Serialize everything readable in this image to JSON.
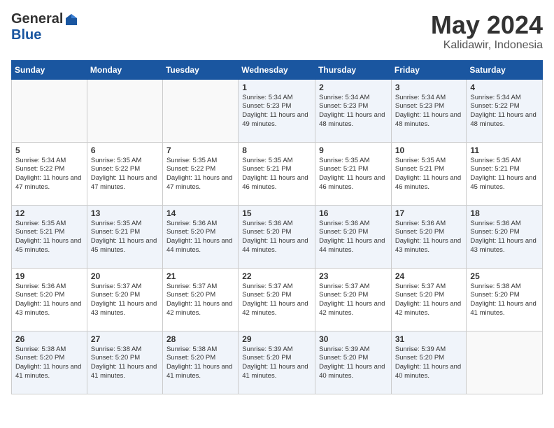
{
  "logo": {
    "general": "General",
    "blue": "Blue"
  },
  "title": "May 2024",
  "subtitle": "Kalidawir, Indonesia",
  "headers": [
    "Sunday",
    "Monday",
    "Tuesday",
    "Wednesday",
    "Thursday",
    "Friday",
    "Saturday"
  ],
  "weeks": [
    [
      {
        "day": "",
        "info": ""
      },
      {
        "day": "",
        "info": ""
      },
      {
        "day": "",
        "info": ""
      },
      {
        "day": "1",
        "info": "Sunrise: 5:34 AM\nSunset: 5:23 PM\nDaylight: 11 hours\nand 49 minutes."
      },
      {
        "day": "2",
        "info": "Sunrise: 5:34 AM\nSunset: 5:23 PM\nDaylight: 11 hours\nand 48 minutes."
      },
      {
        "day": "3",
        "info": "Sunrise: 5:34 AM\nSunset: 5:23 PM\nDaylight: 11 hours\nand 48 minutes."
      },
      {
        "day": "4",
        "info": "Sunrise: 5:34 AM\nSunset: 5:22 PM\nDaylight: 11 hours\nand 48 minutes."
      }
    ],
    [
      {
        "day": "5",
        "info": "Sunrise: 5:34 AM\nSunset: 5:22 PM\nDaylight: 11 hours\nand 47 minutes."
      },
      {
        "day": "6",
        "info": "Sunrise: 5:35 AM\nSunset: 5:22 PM\nDaylight: 11 hours\nand 47 minutes."
      },
      {
        "day": "7",
        "info": "Sunrise: 5:35 AM\nSunset: 5:22 PM\nDaylight: 11 hours\nand 47 minutes."
      },
      {
        "day": "8",
        "info": "Sunrise: 5:35 AM\nSunset: 5:21 PM\nDaylight: 11 hours\nand 46 minutes."
      },
      {
        "day": "9",
        "info": "Sunrise: 5:35 AM\nSunset: 5:21 PM\nDaylight: 11 hours\nand 46 minutes."
      },
      {
        "day": "10",
        "info": "Sunrise: 5:35 AM\nSunset: 5:21 PM\nDaylight: 11 hours\nand 46 minutes."
      },
      {
        "day": "11",
        "info": "Sunrise: 5:35 AM\nSunset: 5:21 PM\nDaylight: 11 hours\nand 45 minutes."
      }
    ],
    [
      {
        "day": "12",
        "info": "Sunrise: 5:35 AM\nSunset: 5:21 PM\nDaylight: 11 hours\nand 45 minutes."
      },
      {
        "day": "13",
        "info": "Sunrise: 5:35 AM\nSunset: 5:21 PM\nDaylight: 11 hours\nand 45 minutes."
      },
      {
        "day": "14",
        "info": "Sunrise: 5:36 AM\nSunset: 5:20 PM\nDaylight: 11 hours\nand 44 minutes."
      },
      {
        "day": "15",
        "info": "Sunrise: 5:36 AM\nSunset: 5:20 PM\nDaylight: 11 hours\nand 44 minutes."
      },
      {
        "day": "16",
        "info": "Sunrise: 5:36 AM\nSunset: 5:20 PM\nDaylight: 11 hours\nand 44 minutes."
      },
      {
        "day": "17",
        "info": "Sunrise: 5:36 AM\nSunset: 5:20 PM\nDaylight: 11 hours\nand 43 minutes."
      },
      {
        "day": "18",
        "info": "Sunrise: 5:36 AM\nSunset: 5:20 PM\nDaylight: 11 hours\nand 43 minutes."
      }
    ],
    [
      {
        "day": "19",
        "info": "Sunrise: 5:36 AM\nSunset: 5:20 PM\nDaylight: 11 hours\nand 43 minutes."
      },
      {
        "day": "20",
        "info": "Sunrise: 5:37 AM\nSunset: 5:20 PM\nDaylight: 11 hours\nand 43 minutes."
      },
      {
        "day": "21",
        "info": "Sunrise: 5:37 AM\nSunset: 5:20 PM\nDaylight: 11 hours\nand 42 minutes."
      },
      {
        "day": "22",
        "info": "Sunrise: 5:37 AM\nSunset: 5:20 PM\nDaylight: 11 hours\nand 42 minutes."
      },
      {
        "day": "23",
        "info": "Sunrise: 5:37 AM\nSunset: 5:20 PM\nDaylight: 11 hours\nand 42 minutes."
      },
      {
        "day": "24",
        "info": "Sunrise: 5:37 AM\nSunset: 5:20 PM\nDaylight: 11 hours\nand 42 minutes."
      },
      {
        "day": "25",
        "info": "Sunrise: 5:38 AM\nSunset: 5:20 PM\nDaylight: 11 hours\nand 41 minutes."
      }
    ],
    [
      {
        "day": "26",
        "info": "Sunrise: 5:38 AM\nSunset: 5:20 PM\nDaylight: 11 hours\nand 41 minutes."
      },
      {
        "day": "27",
        "info": "Sunrise: 5:38 AM\nSunset: 5:20 PM\nDaylight: 11 hours\nand 41 minutes."
      },
      {
        "day": "28",
        "info": "Sunrise: 5:38 AM\nSunset: 5:20 PM\nDaylight: 11 hours\nand 41 minutes."
      },
      {
        "day": "29",
        "info": "Sunrise: 5:39 AM\nSunset: 5:20 PM\nDaylight: 11 hours\nand 41 minutes."
      },
      {
        "day": "30",
        "info": "Sunrise: 5:39 AM\nSunset: 5:20 PM\nDaylight: 11 hours\nand 40 minutes."
      },
      {
        "day": "31",
        "info": "Sunrise: 5:39 AM\nSunset: 5:20 PM\nDaylight: 11 hours\nand 40 minutes."
      },
      {
        "day": "",
        "info": ""
      }
    ]
  ]
}
